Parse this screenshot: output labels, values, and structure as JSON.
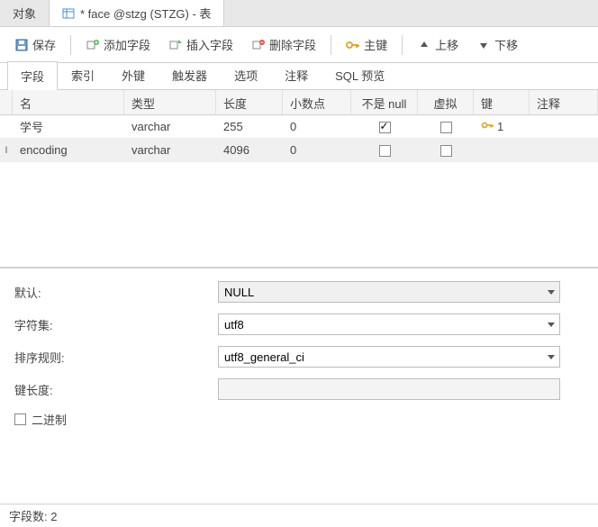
{
  "top_tabs": {
    "object": "对象",
    "current": "* face @stzg (STZG) - 表"
  },
  "toolbar": {
    "save": "保存",
    "add_field": "添加字段",
    "insert_field": "插入字段",
    "delete_field": "删除字段",
    "primary_key": "主键",
    "move_up": "上移",
    "move_down": "下移"
  },
  "sub_tabs": {
    "fields": "字段",
    "indexes": "索引",
    "fks": "外键",
    "triggers": "触发器",
    "options": "选项",
    "comment": "注释",
    "sql_preview": "SQL 预览"
  },
  "grid": {
    "headers": {
      "name": "名",
      "type": "类型",
      "length": "长度",
      "decimals": "小数点",
      "not_null": "不是 null",
      "virtual": "虚拟",
      "key": "键",
      "comment": "注释"
    },
    "rows": [
      {
        "marker": "",
        "name": "学号",
        "type": "varchar",
        "length": "255",
        "decimals": "0",
        "not_null": true,
        "virtual": false,
        "key": "1",
        "has_key": true
      },
      {
        "marker": "I",
        "name": "encoding",
        "type": "varchar",
        "length": "4096",
        "decimals": "0",
        "not_null": false,
        "virtual": false,
        "key": "",
        "has_key": false
      }
    ]
  },
  "props": {
    "default_label": "默认:",
    "default_value": "NULL",
    "charset_label": "字符集:",
    "charset_value": "utf8",
    "collation_label": "排序规则:",
    "collation_value": "utf8_general_ci",
    "key_length_label": "键长度:",
    "key_length_value": "",
    "binary_label": "二进制"
  },
  "status": {
    "field_count_label": "字段数: 2"
  }
}
